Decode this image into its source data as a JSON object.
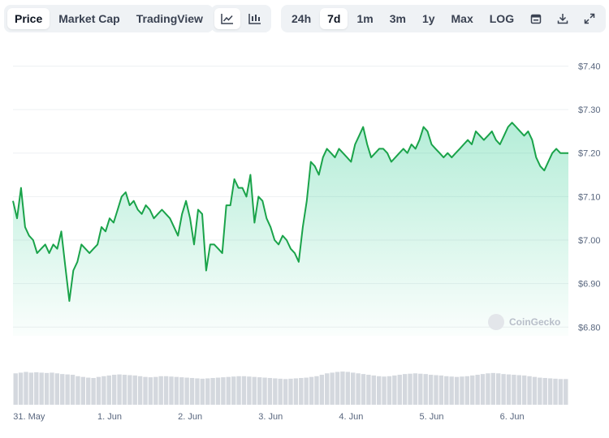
{
  "toolbar": {
    "view_tabs": [
      "Price",
      "Market Cap",
      "TradingView"
    ],
    "active_view": "Price",
    "chart_styles": [
      "line-chart-icon",
      "candlestick-chart-icon"
    ],
    "active_style": "line-chart-icon",
    "ranges": [
      "24h",
      "7d",
      "1m",
      "3m",
      "1y",
      "Max",
      "LOG"
    ],
    "active_range": "7d",
    "actions": [
      "calendar-icon",
      "download-icon",
      "fullscreen-icon"
    ]
  },
  "watermark": "CoinGecko",
  "colors": {
    "line": "#16c784",
    "line_dark": "#1aa34a",
    "fill_top": "#16c784",
    "volume": "#d4d8de",
    "grid": "#eef0f3"
  },
  "chart_data": {
    "type": "area",
    "x_tick_labels": [
      "31. May",
      "1. Jun",
      "2. Jun",
      "3. Jun",
      "4. Jun",
      "5. Jun",
      "6. Jun"
    ],
    "y_tick_labels": [
      "$7.40",
      "$7.30",
      "$7.20",
      "$7.10",
      "$7.00",
      "$6.90",
      "$6.80"
    ],
    "ylim": [
      6.78,
      7.44
    ],
    "xlim": [
      -0.2,
      6.7
    ],
    "grid": true,
    "series": [
      {
        "x": [
          -0.2,
          -0.15,
          -0.1,
          -0.05,
          0.0,
          0.05,
          0.1,
          0.15,
          0.2,
          0.25,
          0.3,
          0.35,
          0.4,
          0.45,
          0.5,
          0.55,
          0.6,
          0.65,
          0.7,
          0.75,
          0.8,
          0.85,
          0.9,
          0.95,
          1.0,
          1.05,
          1.1,
          1.15,
          1.2,
          1.25,
          1.3,
          1.35,
          1.4,
          1.45,
          1.5,
          1.55,
          1.6,
          1.65,
          1.7,
          1.75,
          1.8,
          1.85,
          1.9,
          1.95,
          2.0,
          2.05,
          2.1,
          2.15,
          2.2,
          2.25,
          2.3,
          2.35,
          2.4,
          2.45,
          2.5,
          2.55,
          2.6,
          2.65,
          2.7,
          2.75,
          2.8,
          2.85,
          2.9,
          2.95,
          3.0,
          3.05,
          3.1,
          3.15,
          3.2,
          3.25,
          3.3,
          3.35,
          3.4,
          3.45,
          3.5,
          3.55,
          3.6,
          3.65,
          3.7,
          3.75,
          3.8,
          3.85,
          3.9,
          3.95,
          4.0,
          4.05,
          4.1,
          4.15,
          4.2,
          4.25,
          4.3,
          4.35,
          4.4,
          4.45,
          4.5,
          4.55,
          4.6,
          4.65,
          4.7,
          4.75,
          4.8,
          4.85,
          4.9,
          4.95,
          5.0,
          5.05,
          5.1,
          5.15,
          5.2,
          5.25,
          5.3,
          5.35,
          5.4,
          5.45,
          5.5,
          5.55,
          5.6,
          5.65,
          5.7,
          5.75,
          5.8,
          5.85,
          5.9,
          5.95,
          6.0,
          6.05,
          6.1,
          6.15,
          6.2,
          6.25,
          6.3,
          6.35,
          6.4,
          6.45,
          6.5,
          6.55,
          6.6,
          6.65,
          6.7
        ],
        "values": [
          7.09,
          7.05,
          7.12,
          7.03,
          7.01,
          7.0,
          6.97,
          6.98,
          6.99,
          6.97,
          6.99,
          6.98,
          7.02,
          6.94,
          6.86,
          6.93,
          6.95,
          6.99,
          6.98,
          6.97,
          6.98,
          6.99,
          7.03,
          7.02,
          7.05,
          7.04,
          7.07,
          7.1,
          7.11,
          7.08,
          7.09,
          7.07,
          7.06,
          7.08,
          7.07,
          7.05,
          7.06,
          7.07,
          7.06,
          7.05,
          7.03,
          7.01,
          7.06,
          7.09,
          7.05,
          6.99,
          7.07,
          7.06,
          6.93,
          6.99,
          6.99,
          6.98,
          6.97,
          7.08,
          7.08,
          7.14,
          7.12,
          7.12,
          7.1,
          7.15,
          7.04,
          7.1,
          7.09,
          7.05,
          7.03,
          7.0,
          6.99,
          7.01,
          7.0,
          6.98,
          6.97,
          6.95,
          7.03,
          7.09,
          7.18,
          7.17,
          7.15,
          7.19,
          7.21,
          7.2,
          7.19,
          7.21,
          7.2,
          7.19,
          7.18,
          7.22,
          7.24,
          7.26,
          7.22,
          7.19,
          7.2,
          7.21,
          7.21,
          7.2,
          7.18,
          7.19,
          7.2,
          7.21,
          7.2,
          7.22,
          7.21,
          7.23,
          7.26,
          7.25,
          7.22,
          7.21,
          7.2,
          7.19,
          7.2,
          7.19,
          7.2,
          7.21,
          7.22,
          7.23,
          7.22,
          7.25,
          7.24,
          7.23,
          7.24,
          7.25,
          7.23,
          7.22,
          7.24,
          7.26,
          7.27,
          7.26,
          7.25,
          7.24,
          7.25,
          7.23,
          7.19,
          7.17,
          7.16,
          7.18,
          7.2,
          7.21,
          7.2,
          7.2,
          7.2
        ]
      }
    ],
    "volume_relative": [
      0.88,
      0.9,
      0.92,
      0.9,
      0.91,
      0.9,
      0.89,
      0.9,
      0.88,
      0.86,
      0.85,
      0.84,
      0.8,
      0.78,
      0.76,
      0.75,
      0.78,
      0.8,
      0.82,
      0.84,
      0.85,
      0.84,
      0.83,
      0.82,
      0.8,
      0.78,
      0.77,
      0.78,
      0.8,
      0.8,
      0.79,
      0.78,
      0.77,
      0.76,
      0.75,
      0.74,
      0.73,
      0.74,
      0.75,
      0.76,
      0.77,
      0.78,
      0.79,
      0.8,
      0.8,
      0.79,
      0.78,
      0.77,
      0.76,
      0.75,
      0.74,
      0.73,
      0.72,
      0.73,
      0.74,
      0.75,
      0.76,
      0.78,
      0.8,
      0.84,
      0.88,
      0.9,
      0.92,
      0.93,
      0.92,
      0.9,
      0.88,
      0.86,
      0.84,
      0.82,
      0.8,
      0.79,
      0.8,
      0.82,
      0.84,
      0.86,
      0.87,
      0.88,
      0.87,
      0.86,
      0.84,
      0.83,
      0.82,
      0.8,
      0.79,
      0.78,
      0.79,
      0.8,
      0.82,
      0.84,
      0.86,
      0.88,
      0.89,
      0.88,
      0.86,
      0.85,
      0.84,
      0.83,
      0.82,
      0.8,
      0.78,
      0.76,
      0.75,
      0.74,
      0.73,
      0.72,
      0.72
    ]
  }
}
